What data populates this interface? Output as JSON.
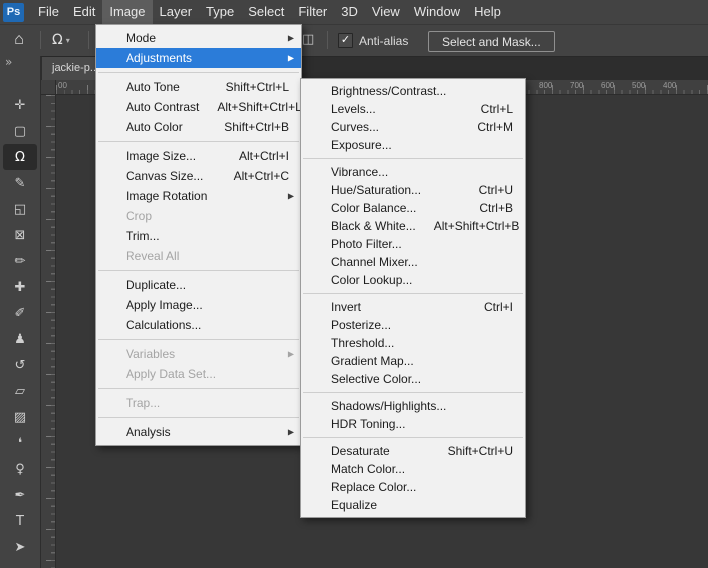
{
  "colors": {
    "menu_highlight_blue": "#2b7cd9",
    "panel_gray": "#434343",
    "menu_bg": "#f1f1f1",
    "logo_blue": "#1f69b4"
  },
  "icons": {
    "home": "⌂",
    "caret_down": "▾",
    "checkmark": "✓",
    "collapse": "»",
    "submenu_arrow": "▶",
    "selection_mode": "◫",
    "lasso": "Ω"
  },
  "menubar": {
    "logo": "Ps",
    "items": [
      {
        "label": "File"
      },
      {
        "label": "Edit"
      },
      {
        "label": "Image",
        "active": true
      },
      {
        "label": "Layer"
      },
      {
        "label": "Type"
      },
      {
        "label": "Select"
      },
      {
        "label": "Filter"
      },
      {
        "label": "3D"
      },
      {
        "label": "View"
      },
      {
        "label": "Window"
      },
      {
        "label": "Help"
      }
    ]
  },
  "options_bar": {
    "anti_alias": {
      "label": "Anti-alias",
      "checked": true
    },
    "select_and_mask": "Select and Mask..."
  },
  "toolbar": {
    "tools": [
      {
        "name": "move-tool",
        "glyph": "✛"
      },
      {
        "name": "rectangular-marquee-tool",
        "glyph": "▢"
      },
      {
        "name": "lasso-tool",
        "glyph": "Ω",
        "selected": true
      },
      {
        "name": "quick-selection-tool",
        "glyph": "✎"
      },
      {
        "name": "crop-tool",
        "glyph": "◱"
      },
      {
        "name": "frame-tool",
        "glyph": "⊠"
      },
      {
        "name": "eyedropper-tool",
        "glyph": "✏"
      },
      {
        "name": "healing-brush-tool",
        "glyph": "✚"
      },
      {
        "name": "brush-tool",
        "glyph": "✐"
      },
      {
        "name": "clone-stamp-tool",
        "glyph": "♟"
      },
      {
        "name": "history-brush-tool",
        "glyph": "↺"
      },
      {
        "name": "eraser-tool",
        "glyph": "▱"
      },
      {
        "name": "gradient-tool",
        "glyph": "▨"
      },
      {
        "name": "blur-tool",
        "glyph": "❛"
      },
      {
        "name": "dodge-tool",
        "glyph": "♀"
      },
      {
        "name": "pen-tool",
        "glyph": "✒"
      },
      {
        "name": "type-tool",
        "glyph": "T"
      },
      {
        "name": "path-selection-tool",
        "glyph": "➤"
      }
    ]
  },
  "document_tab": {
    "label": "jackie-p..."
  },
  "ruler": {
    "left_label": "00",
    "right_labels": [
      "800",
      "700",
      "600",
      "500",
      "400"
    ]
  },
  "image_menu": {
    "items": [
      {
        "label": "Mode",
        "submenu": true
      },
      {
        "label": "Adjustments",
        "submenu": true,
        "highlighted": true
      },
      {
        "separator": true
      },
      {
        "label": "Auto Tone",
        "shortcut": "Shift+Ctrl+L"
      },
      {
        "label": "Auto Contrast",
        "shortcut": "Alt+Shift+Ctrl+L"
      },
      {
        "label": "Auto Color",
        "shortcut": "Shift+Ctrl+B"
      },
      {
        "separator": true
      },
      {
        "label": "Image Size...",
        "shortcut": "Alt+Ctrl+I"
      },
      {
        "label": "Canvas Size...",
        "shortcut": "Alt+Ctrl+C"
      },
      {
        "label": "Image Rotation",
        "submenu": true
      },
      {
        "label": "Crop",
        "disabled": true
      },
      {
        "label": "Trim..."
      },
      {
        "label": "Reveal All",
        "disabled": true
      },
      {
        "separator": true
      },
      {
        "label": "Duplicate..."
      },
      {
        "label": "Apply Image..."
      },
      {
        "label": "Calculations..."
      },
      {
        "separator": true
      },
      {
        "label": "Variables",
        "submenu": true,
        "disabled": true
      },
      {
        "label": "Apply Data Set...",
        "disabled": true
      },
      {
        "separator": true
      },
      {
        "label": "Trap...",
        "disabled": true
      },
      {
        "separator": true
      },
      {
        "label": "Analysis",
        "submenu": true
      }
    ]
  },
  "adjustments_menu": {
    "items": [
      {
        "label": "Brightness/Contrast..."
      },
      {
        "label": "Levels...",
        "shortcut": "Ctrl+L"
      },
      {
        "label": "Curves...",
        "shortcut": "Ctrl+M"
      },
      {
        "label": "Exposure..."
      },
      {
        "separator": true
      },
      {
        "label": "Vibrance..."
      },
      {
        "label": "Hue/Saturation...",
        "shortcut": "Ctrl+U"
      },
      {
        "label": "Color Balance...",
        "shortcut": "Ctrl+B"
      },
      {
        "label": "Black & White...",
        "shortcut": "Alt+Shift+Ctrl+B"
      },
      {
        "label": "Photo Filter..."
      },
      {
        "label": "Channel Mixer..."
      },
      {
        "label": "Color Lookup..."
      },
      {
        "separator": true
      },
      {
        "label": "Invert",
        "shortcut": "Ctrl+I"
      },
      {
        "label": "Posterize..."
      },
      {
        "label": "Threshold..."
      },
      {
        "label": "Gradient Map..."
      },
      {
        "label": "Selective Color..."
      },
      {
        "separator": true
      },
      {
        "label": "Shadows/Highlights..."
      },
      {
        "label": "HDR Toning..."
      },
      {
        "separator": true
      },
      {
        "label": "Desaturate",
        "shortcut": "Shift+Ctrl+U"
      },
      {
        "label": "Match Color..."
      },
      {
        "label": "Replace Color..."
      },
      {
        "label": "Equalize"
      }
    ]
  }
}
